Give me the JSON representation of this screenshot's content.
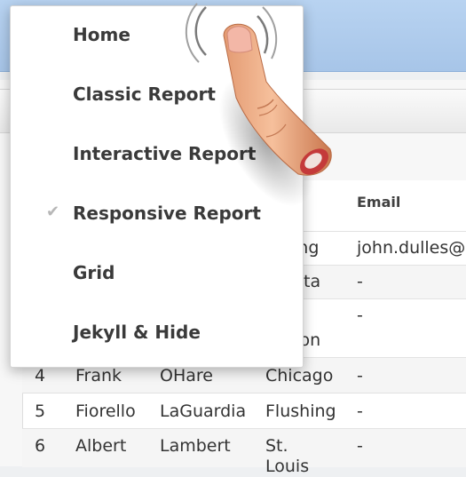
{
  "menu": {
    "items": [
      {
        "label": "Home",
        "selected": false
      },
      {
        "label": "Classic Report",
        "selected": false
      },
      {
        "label": "Interactive Report",
        "selected": false
      },
      {
        "label": "Responsive Report",
        "selected": true
      },
      {
        "label": "Grid",
        "selected": false
      },
      {
        "label": "Jekyll & Hide",
        "selected": false
      }
    ]
  },
  "table": {
    "email_header": "Email",
    "rows": [
      {
        "id": "",
        "first": "",
        "last": "",
        "city": "ing",
        "email": "john.dulles@"
      },
      {
        "id": "",
        "first": "",
        "last": "",
        "city": "nta",
        "email": "-"
      },
      {
        "id": "",
        "first": "",
        "last": "",
        "city": "ton",
        "email": "-"
      },
      {
        "id": "4",
        "first": "Frank",
        "last": "OHare",
        "city": "Chicago",
        "email": "-"
      },
      {
        "id": "5",
        "first": "Fiorello",
        "last": "LaGuardia",
        "city": "Flushing",
        "email": "-"
      },
      {
        "id": "6",
        "first": "Albert",
        "last": "Lambert",
        "city": "St.",
        "city2": "Louis",
        "email": "-"
      }
    ]
  },
  "colors": {
    "topbar": "#b0cdee",
    "menu_text": "#3a3a3a",
    "checkmark": "#b7b7b7"
  }
}
